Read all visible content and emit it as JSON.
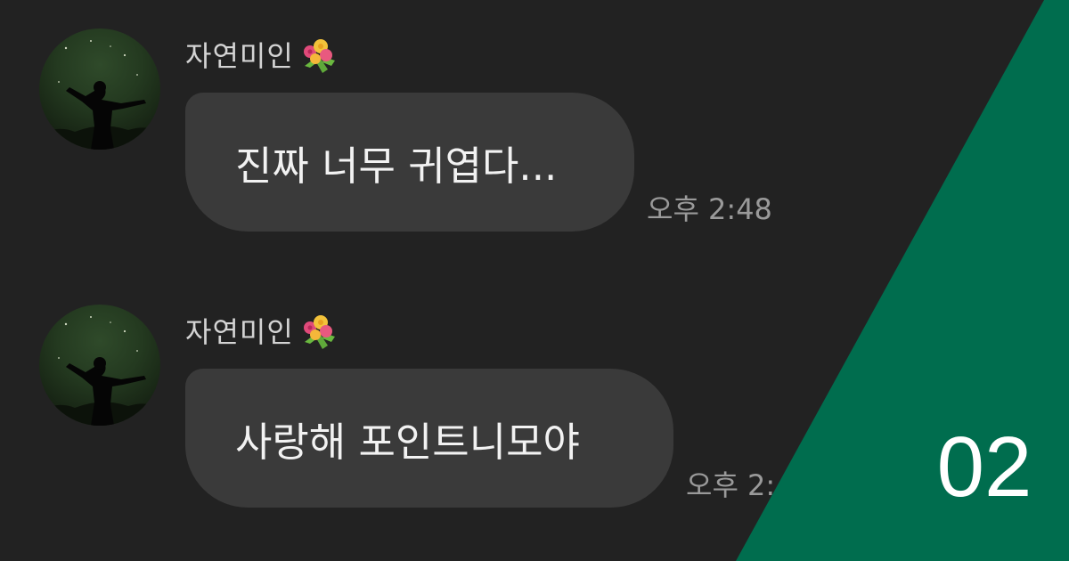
{
  "messages": [
    {
      "sender": "자연미인",
      "sender_icon": "bouquet-icon",
      "text": "진짜 너무 귀엽다...",
      "time": "오후 2:48"
    },
    {
      "sender": "자연미인",
      "sender_icon": "bouquet-icon",
      "text": "사랑해 포인트니모야",
      "time": "오후 2:48"
    }
  ],
  "page_number": "02",
  "colors": {
    "background": "#222222",
    "bubble": "#3a3a3a",
    "accent": "#006d4e",
    "name_text": "#d4d4d4",
    "message_text": "#f2f2f2",
    "time_text": "#9a9a9a"
  }
}
